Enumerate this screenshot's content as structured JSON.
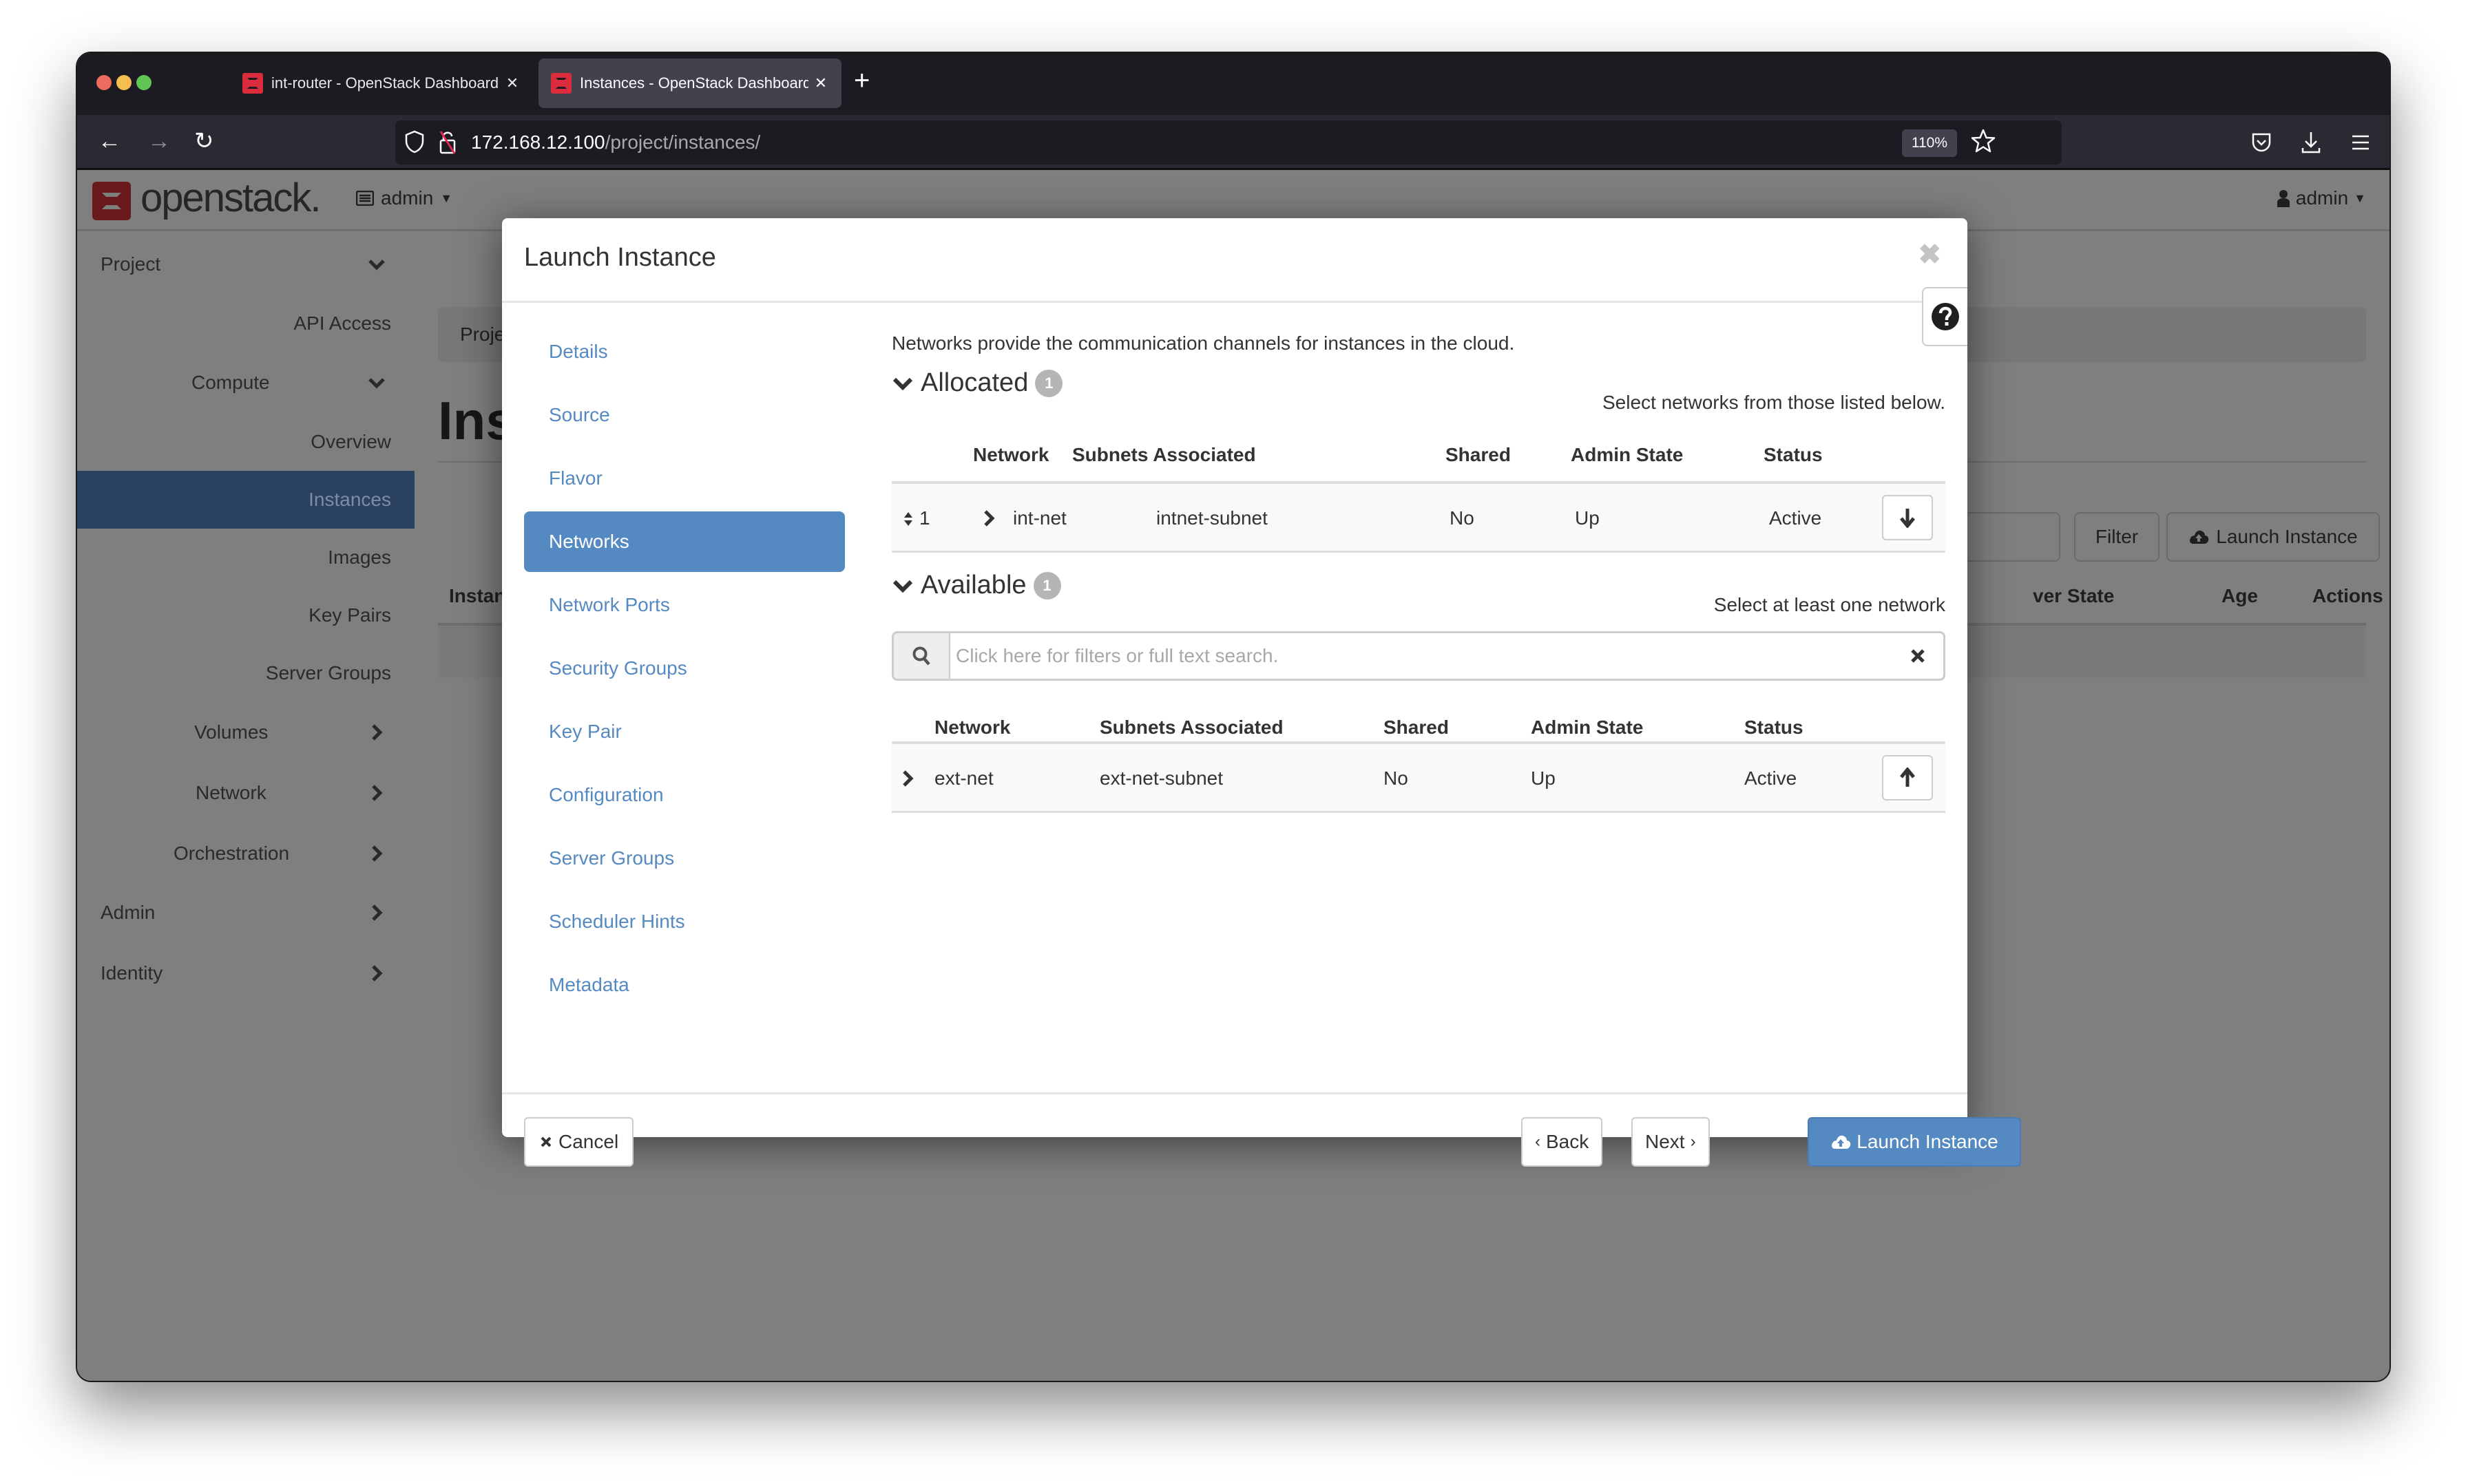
{
  "browser": {
    "tabs": [
      {
        "title": "int-router - OpenStack Dashboard",
        "active": false
      },
      {
        "title": "Instances - OpenStack Dashboard",
        "active": true
      }
    ],
    "new_tab_label": "+",
    "url_host": "172.168.12.100",
    "url_path": "/project/instances/",
    "zoom_level": "110%"
  },
  "topnav": {
    "logo_text": "openstack.",
    "project_selector": "admin",
    "user_menu": "admin"
  },
  "sidebar": {
    "items": [
      {
        "label": "Project",
        "level": 0,
        "chevron": "down"
      },
      {
        "label": "API Access",
        "level": 2
      },
      {
        "label": "Compute",
        "level": 1,
        "chevron": "down"
      },
      {
        "label": "Overview",
        "level": 2
      },
      {
        "label": "Instances",
        "level": 2,
        "active": true
      },
      {
        "label": "Images",
        "level": 2
      },
      {
        "label": "Key Pairs",
        "level": 2
      },
      {
        "label": "Server Groups",
        "level": 2
      },
      {
        "label": "Volumes",
        "level": 1,
        "chevron": "right"
      },
      {
        "label": "Network",
        "level": 1,
        "chevron": "right"
      },
      {
        "label": "Orchestration",
        "level": 1,
        "chevron": "right"
      },
      {
        "label": "Admin",
        "level": 0,
        "chevron": "right"
      },
      {
        "label": "Identity",
        "level": 0,
        "chevron": "right"
      }
    ]
  },
  "background_page": {
    "breadcrumb": "Proje",
    "title": "Ins",
    "filter_button": "Filter",
    "launch_button": "Launch Instance",
    "columns": [
      "Instan",
      "ver State",
      "Age",
      "Actions"
    ]
  },
  "modal": {
    "title": "Launch Instance",
    "steps": [
      {
        "label": "Details"
      },
      {
        "label": "Source"
      },
      {
        "label": "Flavor"
      },
      {
        "label": "Networks",
        "active": true
      },
      {
        "label": "Network Ports"
      },
      {
        "label": "Security Groups"
      },
      {
        "label": "Key Pair"
      },
      {
        "label": "Configuration"
      },
      {
        "label": "Server Groups"
      },
      {
        "label": "Scheduler Hints"
      },
      {
        "label": "Metadata"
      }
    ],
    "intro": "Networks provide the communication channels for instances in the cloud.",
    "allocated": {
      "heading": "Allocated",
      "count": "1",
      "hint": "Select networks from those listed below.",
      "columns": [
        "Network",
        "Subnets Associated",
        "Shared",
        "Admin State",
        "Status"
      ],
      "rows": [
        {
          "order": "1",
          "network": "int-net",
          "subnets": "intnet-subnet",
          "shared": "No",
          "admin_state": "Up",
          "status": "Active"
        }
      ]
    },
    "available": {
      "heading": "Available",
      "count": "1",
      "hint": "Select at least one network",
      "search_placeholder": "Click here for filters or full text search.",
      "search_value": "",
      "columns": [
        "Network",
        "Subnets Associated",
        "Shared",
        "Admin State",
        "Status"
      ],
      "rows": [
        {
          "network": "ext-net",
          "subnets": "ext-net-subnet",
          "shared": "No",
          "admin_state": "Up",
          "status": "Active"
        }
      ]
    },
    "footer": {
      "cancel": "Cancel",
      "back": "Back",
      "next": "Next",
      "launch": "Launch Instance"
    }
  },
  "colors": {
    "accent": "#5589c2",
    "sidebar_active": "#2a415f",
    "openstack_red": "#da2c3c"
  }
}
